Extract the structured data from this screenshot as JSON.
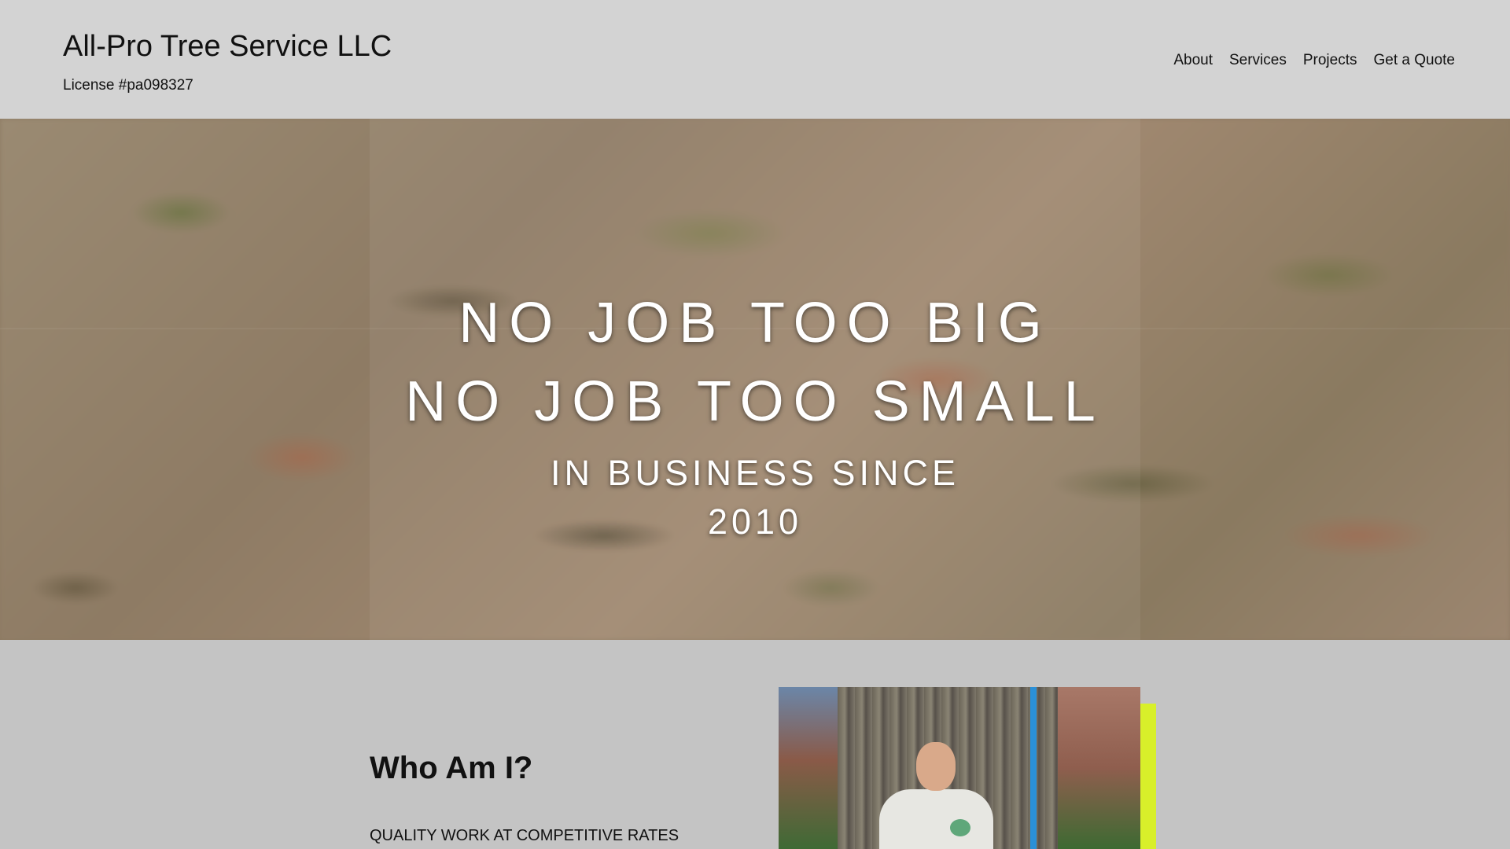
{
  "header": {
    "site_title": "All-Pro Tree Service LLC",
    "license": "License #pa098327",
    "nav": [
      "About",
      "Services",
      "Projects",
      "Get a Quote"
    ]
  },
  "hero": {
    "headline_line1": "NO JOB TOO BIG",
    "headline_line2": "NO JOB TOO SMALL",
    "sub_line1": "IN BUSINESS SINCE",
    "sub_line2": "2010"
  },
  "about": {
    "title": "Who Am I?",
    "subtitle": "QUALITY WORK AT COMPETITIVE RATES"
  },
  "colors": {
    "header_bg": "#d3d3d3",
    "page_bg": "#c4c4c4",
    "accent": "#d8ef2a"
  }
}
